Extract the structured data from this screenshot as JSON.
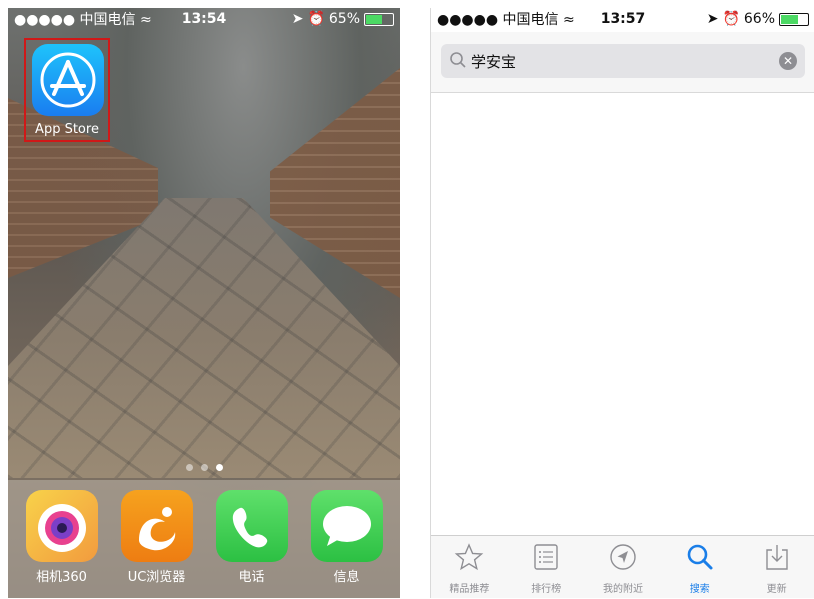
{
  "left_screen": {
    "status": {
      "signal": "●●●●● 中国电信 ≈",
      "time": "13:54",
      "battery": "65%",
      "battery_level": 0.65
    },
    "app_store_label": "App Store",
    "page_dots": {
      "count": 3,
      "active_index": 2
    },
    "dock": [
      {
        "label": "相机360",
        "icon": "camera360-icon",
        "color": "#f0c040"
      },
      {
        "label": "UC浏览器",
        "icon": "uc-browser-icon",
        "color": "#f29418"
      },
      {
        "label": "电话",
        "icon": "phone-icon",
        "color": "#4cd964"
      },
      {
        "label": "信息",
        "icon": "messages-icon",
        "color": "#4cd964"
      }
    ]
  },
  "right_screen": {
    "status": {
      "signal": "●●●●● 中国电信 ≈",
      "time": "13:57",
      "battery": "66%",
      "battery_level": 0.66
    },
    "search": {
      "value": "学安宝"
    },
    "tabs": [
      {
        "label": "精品推荐",
        "icon": "star-icon",
        "active": false
      },
      {
        "label": "排行榜",
        "icon": "list-icon",
        "active": false
      },
      {
        "label": "我的附近",
        "icon": "location-arrow-icon",
        "active": false
      },
      {
        "label": "搜索",
        "icon": "search-icon",
        "active": true
      },
      {
        "label": "更新",
        "icon": "download-tray-icon",
        "active": false
      }
    ],
    "accent_color": "#1a7ee8"
  }
}
